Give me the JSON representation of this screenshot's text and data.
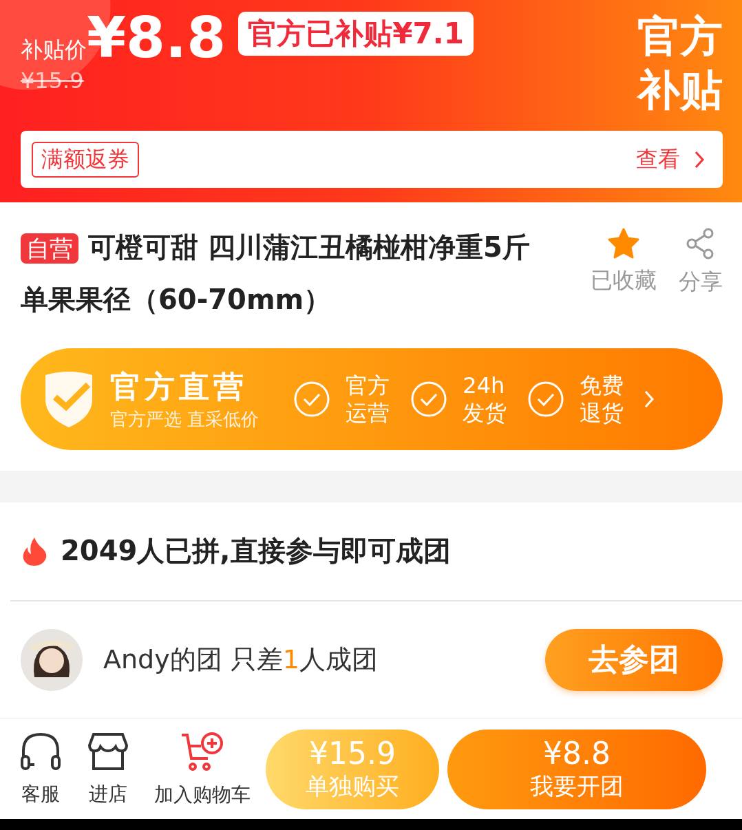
{
  "header": {
    "price_label": "补贴价",
    "price": "¥8.8",
    "subsidy_badge": "官方已补贴¥7.1",
    "original_price": "¥15.9",
    "corner_title": [
      "官方",
      "补贴"
    ],
    "coupon": {
      "tag": "满额返券",
      "link": "查看"
    }
  },
  "product": {
    "badge": "自营",
    "title": "可橙可甜 四川蒲江丑橘椪柑净重5斤单果果径（60-70mm）",
    "actions": [
      {
        "kind": "favorite",
        "label": "已收藏",
        "on": true
      },
      {
        "kind": "share",
        "label": "分享"
      }
    ]
  },
  "banner": {
    "title": "官方直营",
    "subtitle": "官方严选 直采低价",
    "features": [
      {
        "lines": [
          "官方",
          "运营"
        ]
      },
      {
        "lines": [
          "24h",
          "发货"
        ]
      },
      {
        "lines": [
          "免费",
          "退货"
        ]
      }
    ]
  },
  "group": {
    "headline": "2049人已拼,直接参与即可成团",
    "team": {
      "name": "Andy的团",
      "need_prefix": "只差",
      "need_count": "1",
      "need_suffix": "人成团",
      "button": "去参团"
    }
  },
  "bottom_bar": {
    "items": [
      {
        "kind": "service",
        "label": "客服"
      },
      {
        "kind": "store",
        "label": "进店"
      },
      {
        "kind": "cart",
        "label": "加入购物车"
      }
    ],
    "buy_alone": {
      "price": "¥15.9",
      "label": "单独购买"
    },
    "group_buy": {
      "price": "¥8.8",
      "label": "我要开团"
    }
  }
}
